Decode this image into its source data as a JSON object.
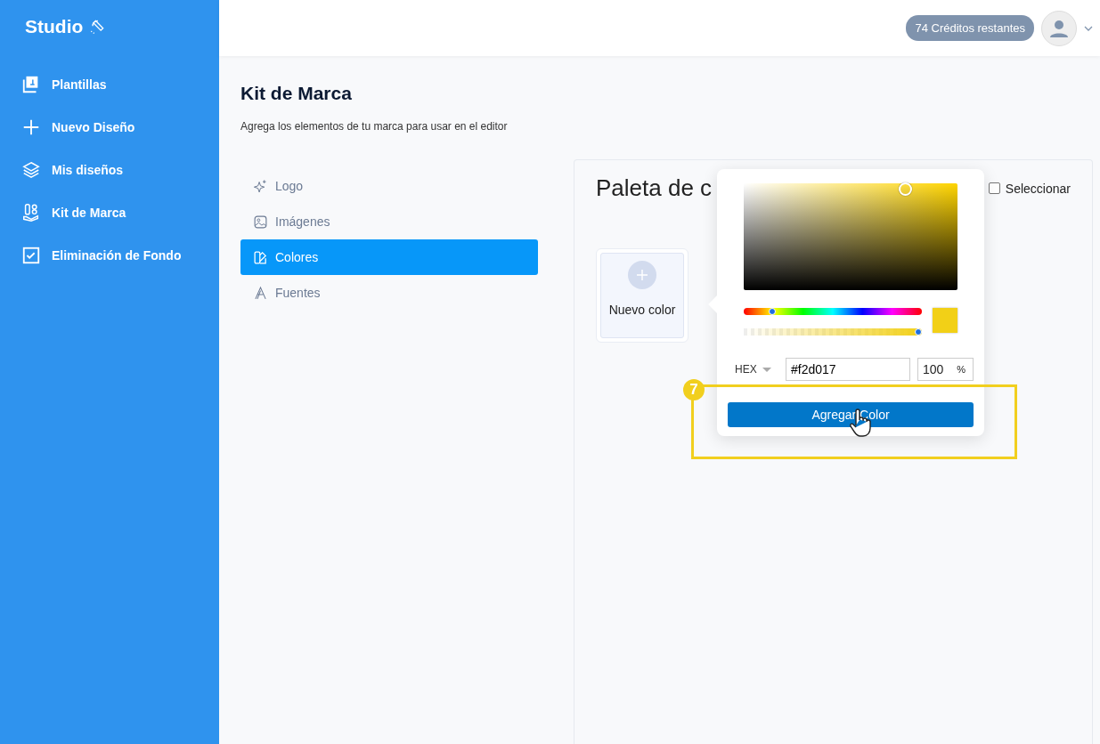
{
  "sidebar": {
    "logo": "Studio",
    "items": [
      {
        "label": "Plantillas",
        "kind": "templates"
      },
      {
        "label": "Nuevo Diseño",
        "kind": "plus"
      },
      {
        "label": "Mis diseños",
        "kind": "layers"
      },
      {
        "label": "Kit de Marca",
        "kind": "kit"
      },
      {
        "label": "Eliminación de Fondo",
        "kind": "check"
      }
    ]
  },
  "topbar": {
    "credits": "74 Créditos restantes"
  },
  "page": {
    "title": "Kit de Marca",
    "subtitle": "Agrega los elementos de tu marca para usar en el editor"
  },
  "brand_nav": [
    {
      "label": "Logo",
      "kind": "sparkle",
      "selected": false
    },
    {
      "label": "Imágenes",
      "kind": "image",
      "selected": false
    },
    {
      "label": "Colores",
      "kind": "palette",
      "selected": true
    },
    {
      "label": "Fuentes",
      "kind": "font",
      "selected": false
    }
  ],
  "palette": {
    "title": "Paleta de c",
    "select_label": "Seleccionar",
    "select_checked": false,
    "new_color": "Nuevo color"
  },
  "color_picker": {
    "hue_slider": {
      "level": 0.14
    },
    "alpha_slider": {
      "level": 1
    },
    "format": "HEX",
    "hex_value": "#f2d017",
    "alpha_value": "100",
    "alpha_unit": "%",
    "button": "Agregar Color"
  },
  "annotation": {
    "step": "7"
  }
}
